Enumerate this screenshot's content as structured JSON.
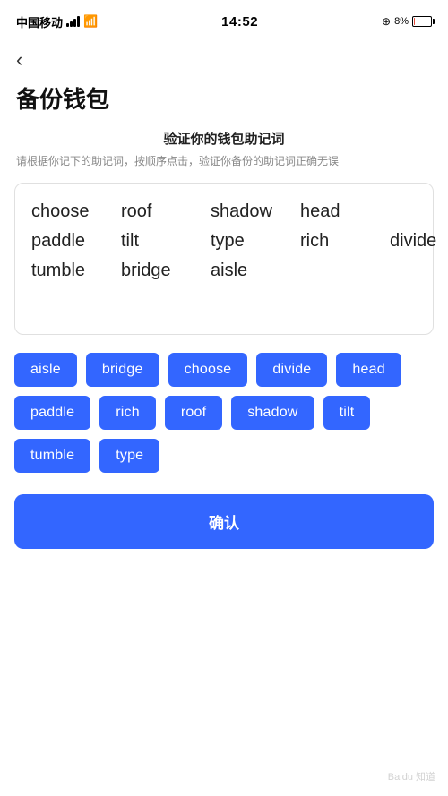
{
  "statusBar": {
    "carrier": "中国移动",
    "time": "14:52",
    "batteryPct": "8%",
    "icons": {
      "signal": "signal-icon",
      "wifi": "wifi-icon",
      "satellite": "satellite-icon",
      "battery": "battery-icon"
    }
  },
  "nav": {
    "backLabel": "‹"
  },
  "page": {
    "title": "备份钱包"
  },
  "verifySection": {
    "heading": "验证你的钱包助记词",
    "desc": "请根据你记下的助记词，按顺序点击，验证你备份的助记词正确无误"
  },
  "displayWords": [
    {
      "word": "choose"
    },
    {
      "word": "roof"
    },
    {
      "word": "shadow"
    },
    {
      "word": "head"
    },
    {
      "word": "paddle"
    },
    {
      "word": "tilt"
    },
    {
      "word": "type"
    },
    {
      "word": "rich"
    },
    {
      "word": "divide"
    },
    {
      "word": "tumble"
    },
    {
      "word": "bridge"
    },
    {
      "word": "aisle"
    }
  ],
  "chips": [
    "aisle",
    "bridge",
    "choose",
    "divide",
    "head",
    "paddle",
    "rich",
    "roof",
    "shadow",
    "tilt",
    "tumble",
    "type"
  ],
  "confirmButton": {
    "label": "确认"
  },
  "watermark": "Baidu 知道"
}
